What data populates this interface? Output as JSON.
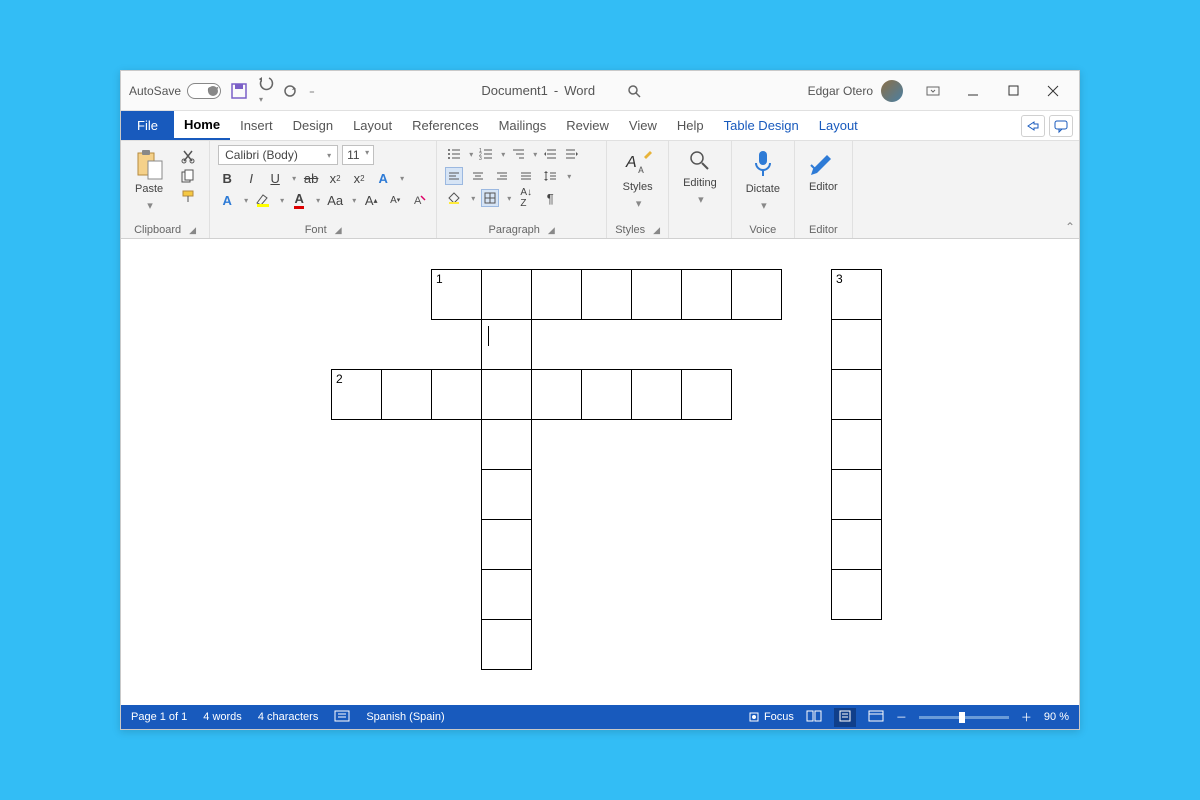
{
  "titlebar": {
    "autosave_label": "AutoSave",
    "autosave_state": "Off",
    "doc_title": "Document1",
    "app_name": "Word",
    "user_name": "Edgar Otero"
  },
  "tabs": {
    "file": "File",
    "items": [
      "Home",
      "Insert",
      "Design",
      "Layout",
      "References",
      "Mailings",
      "Review",
      "View",
      "Help"
    ],
    "contextual": [
      "Table Design",
      "Layout"
    ],
    "active": "Home"
  },
  "ribbon": {
    "clipboard": {
      "label": "Clipboard",
      "paste": "Paste"
    },
    "font": {
      "label": "Font",
      "name": "Calibri (Body)",
      "size": "11"
    },
    "paragraph": {
      "label": "Paragraph"
    },
    "styles": {
      "label": "Styles",
      "btn": "Styles"
    },
    "editing": {
      "label": "",
      "btn": "Editing"
    },
    "voice": {
      "label": "Voice",
      "btn": "Dictate"
    },
    "editor": {
      "label": "Editor",
      "btn": "Editor"
    }
  },
  "crossword": {
    "clue_numbers": {
      "row0_col0": "1",
      "row0_col8": "3",
      "row2_col_minus2": "2"
    }
  },
  "statusbar": {
    "page": "Page 1 of 1",
    "words": "4 words",
    "chars": "4 characters",
    "lang": "Spanish (Spain)",
    "focus": "Focus",
    "zoom": "90 %"
  }
}
